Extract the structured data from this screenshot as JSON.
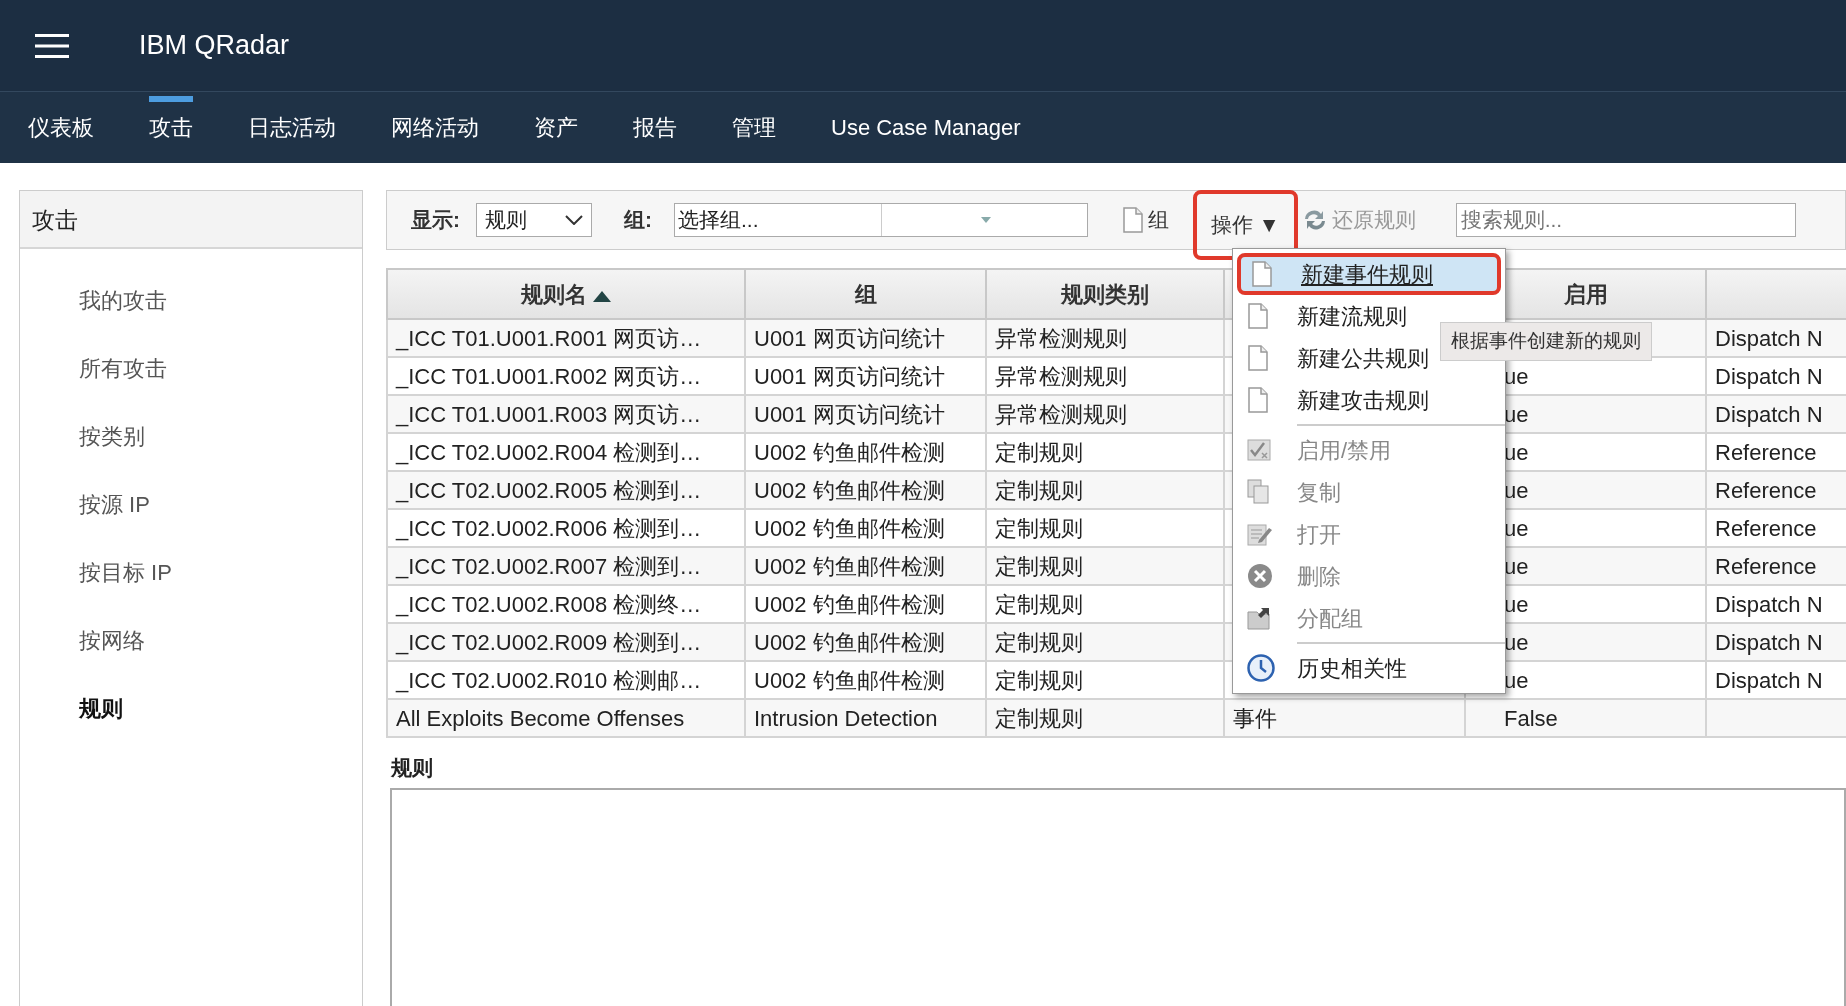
{
  "app": {
    "title": "IBM QRadar"
  },
  "nav_tabs": [
    {
      "label": "仪表板",
      "selected": false
    },
    {
      "label": "攻击",
      "selected": true
    },
    {
      "label": "日志活动",
      "selected": false
    },
    {
      "label": "网络活动",
      "selected": false
    },
    {
      "label": "资产",
      "selected": false
    },
    {
      "label": "报告",
      "selected": false
    },
    {
      "label": "管理",
      "selected": false
    },
    {
      "label": "Use Case Manager",
      "selected": false
    }
  ],
  "sidebar": {
    "title": "攻击",
    "items": [
      {
        "label": "我的攻击",
        "selected": false
      },
      {
        "label": "所有攻击",
        "selected": false
      },
      {
        "label": "按类别",
        "selected": false
      },
      {
        "label": "按源 IP",
        "selected": false
      },
      {
        "label": "按目标 IP",
        "selected": false
      },
      {
        "label": "按网络",
        "selected": false
      },
      {
        "label": "规则",
        "selected": true
      }
    ]
  },
  "toolbar": {
    "display_label": "显示:",
    "display_value": "规则",
    "group_label": "组:",
    "group_value": "选择组...",
    "group_button": "组",
    "actions_label": "操作",
    "actions_caret": "▼",
    "revert": {
      "label": "还原规则",
      "disabled": true
    },
    "search": {
      "placeholder": "搜索规则..."
    }
  },
  "table": {
    "headers": {
      "rule_name": {
        "label": "规则名",
        "sorted_ascending": true
      },
      "group": {
        "label": "组",
        "sorted_ascending": false
      },
      "category": {
        "label": "规则类别",
        "sorted_ascending": false
      },
      "enabled": {
        "label": "启用",
        "sorted_ascending": false
      }
    },
    "rows": [
      {
        "rule_name": "_ICC T01.U001.R001 网页访…",
        "group": "U001 网页访问统计",
        "category": "异常检测规则",
        "column_6": "Dispatch N"
      },
      {
        "rule_name": "_ICC T01.U001.R002 网页访…",
        "group": "U001 网页访问统计",
        "category": "异常检测规则",
        "enabled": "ue",
        "column_6": "Dispatch N"
      },
      {
        "rule_name": "_ICC T01.U001.R003 网页访…",
        "group": "U001 网页访问统计",
        "category": "异常检测规则",
        "enabled": "ue",
        "column_6": "Dispatch N"
      },
      {
        "rule_name": "_ICC T02.U002.R004 检测到…",
        "group": "U002 钓鱼邮件检测",
        "category": "定制规则",
        "enabled": "ue",
        "column_6": "Reference"
      },
      {
        "rule_name": "_ICC T02.U002.R005 检测到…",
        "group": "U002 钓鱼邮件检测",
        "category": "定制规则",
        "enabled": "ue",
        "column_6": "Reference"
      },
      {
        "rule_name": "_ICC T02.U002.R006 检测到…",
        "group": "U002 钓鱼邮件检测",
        "category": "定制规则",
        "enabled": "ue",
        "column_6": "Reference"
      },
      {
        "rule_name": "_ICC T02.U002.R007 检测到…",
        "group": "U002 钓鱼邮件检测",
        "category": "定制规则",
        "enabled": "ue",
        "column_6": "Reference"
      },
      {
        "rule_name": "_ICC T02.U002.R008 检测终…",
        "group": "U002 钓鱼邮件检测",
        "category": "定制规则",
        "enabled": "ue",
        "column_6": "Dispatch N"
      },
      {
        "rule_name": "_ICC T02.U002.R009 检测到…",
        "group": "U002 钓鱼邮件检测",
        "category": "定制规则",
        "enabled": "ue",
        "column_6": "Dispatch N"
      },
      {
        "rule_name": "_ICC T02.U002.R010 检测邮…",
        "group": "U002 钓鱼邮件检测",
        "category": "定制规则",
        "enabled": "ue",
        "column_6": "Dispatch N"
      },
      {
        "rule_name": "All Exploits Become Offenses",
        "group": "Intrusion Detection",
        "category": "定制规则",
        "column_4": "事件",
        "enabled": "False"
      }
    ]
  },
  "actions_menu": {
    "sections": [
      {
        "items": [
          {
            "label": "新建事件规则",
            "selected": true,
            "disabled": false
          },
          {
            "label": "新建流规则",
            "selected": false,
            "disabled": false
          },
          {
            "label": "新建公共规则",
            "selected": false,
            "disabled": false
          },
          {
            "label": "新建攻击规则",
            "selected": false,
            "disabled": false
          }
        ]
      },
      {
        "items": [
          {
            "label": "启用/禁用",
            "selected": false,
            "disabled": true
          },
          {
            "label": "复制",
            "selected": false,
            "disabled": true
          },
          {
            "label": "打开",
            "selected": false,
            "disabled": true
          },
          {
            "label": "删除",
            "selected": false,
            "disabled": true
          },
          {
            "label": "分配组",
            "selected": false,
            "disabled": true
          }
        ]
      },
      {
        "items": [
          {
            "label": "历史相关性",
            "selected": false,
            "disabled": false
          }
        ]
      }
    ]
  },
  "tooltip": "根据事件创建新的规则",
  "detail": {
    "title": "规则"
  }
}
